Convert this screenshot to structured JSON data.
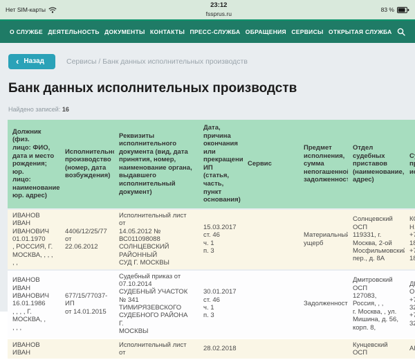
{
  "status_bar": {
    "carrier": "Нет SIM-карты",
    "time": "23:12",
    "url": "fssprus.ru",
    "battery": "83 %"
  },
  "nav": {
    "items": [
      "О СЛУЖБЕ",
      "ДЕЯТЕЛЬНОСТЬ",
      "ДОКУМЕНТЫ",
      "КОНТАКТЫ",
      "ПРЕСС-СЛУЖБА",
      "ОБРАЩЕНИЯ",
      "СЕРВИСЫ",
      "ОТКРЫТАЯ СЛУЖБА"
    ],
    "search_icon": "magnifier"
  },
  "breadcrumb": {
    "back_label": "Назад",
    "back_chevron": "‹",
    "path": "Сервисы / Банк данных исполнительных производств"
  },
  "page": {
    "title": "Банк данных исполнительных производств",
    "results_label": "Найдено записей:",
    "results_count": "16"
  },
  "table": {
    "headers": [
      "Должник (физ.\nлицо: ФИО,\nдата и место\nрождения; юр.\nлицо:\nнаименование,\nюр. адрес)",
      "Исполнительное\nпроизводство\n(номер, дата\nвозбуждения)",
      "Реквизиты\nисполнительного\nдокумента (вид, дата\nпринятия, номер,\nнаименование органа,\nвыдавшего\nисполнительный\nдокумент)",
      "Дата,\nпричина\nокончания\nили\nпрекращения\nИП (статья,\nчасть, пункт\nоснования)",
      "Сервис",
      "Предмет\nисполнения,\nсумма\nнепогашенной\nзадолженности",
      "Отдел\nсудебных\nприставов\n(наименование,\nадрес)",
      "Су\nпр\nис"
    ],
    "rows": [
      {
        "debtor": "ИВАНОВ ИВАН\nИВАНОВИЧ\n01.01.1970\n, РОССИЯ, Г.\nМОСКВА, , , , , ,",
        "proceeding": "4406/12/25/77 от\n22.06.2012",
        "document": "Исполнительный лист от\n14.05.2012 № ВС011098088\nСОЛНЦЕВСКИЙ РАЙОННЫЙ\nСУД Г. МОСКВЫ",
        "end_reason": "15.03.2017\nст. 46\nч. 1\nп. 3",
        "service": "",
        "subject": "Материальный\nущерб",
        "department": "Солнцевский\nОСП\n119331, г.\nМосква, 2-ой\nМосфильмовский\nпер., д. 8А",
        "bailiff": "КО\nН.\n+7(\n18-\n+7(\n18-"
      },
      {
        "debtor": "ИВАНОВ ИВАН\nИВАНОВИЧ\n16.01.1986\n, , , , Г. МОСКВА, ,\n, , ,",
        "proceeding": "677/15/77037-ИП\nот 14.01.2015",
        "document": "Судебный приказ от\n07.10.2014\nСУДЕБНЫЙ УЧАСТОК № 341\nТИМИРЯЗЕВСКОГО\nСУДЕБНОГО РАЙОНА Г.\nМОСКВЫ",
        "end_reason": "30.01.2017\nст. 46\nч. 1\nп. 3",
        "service": "",
        "subject": "Задолженность",
        "department": "Дмитровский\nОСП\n127083, Россия, , ,\nг. Москва, , ул.\nМишина, д. 56,\nкорп. 8,",
        "bailiff": "ДЕ\nО.\n+7(\n32-\n+7(\n32-"
      },
      {
        "debtor": "ИВАНОВ ИВАН",
        "proceeding": "",
        "document": "Исполнительный лист от",
        "end_reason": "28.02.2018",
        "service": "",
        "subject": "",
        "department": "Кунцевский ОСП",
        "bailiff": "АК"
      }
    ]
  },
  "colors": {
    "nav_green": "#1f7b66",
    "nav_edge_green": "#0d926c",
    "header_green": "#a7ddbf",
    "back_button_teal": "#2aa2b8",
    "row_cream": "#faf6e6",
    "status_bar_green": "#d9e9dc",
    "page_background": "#e9edf0"
  }
}
